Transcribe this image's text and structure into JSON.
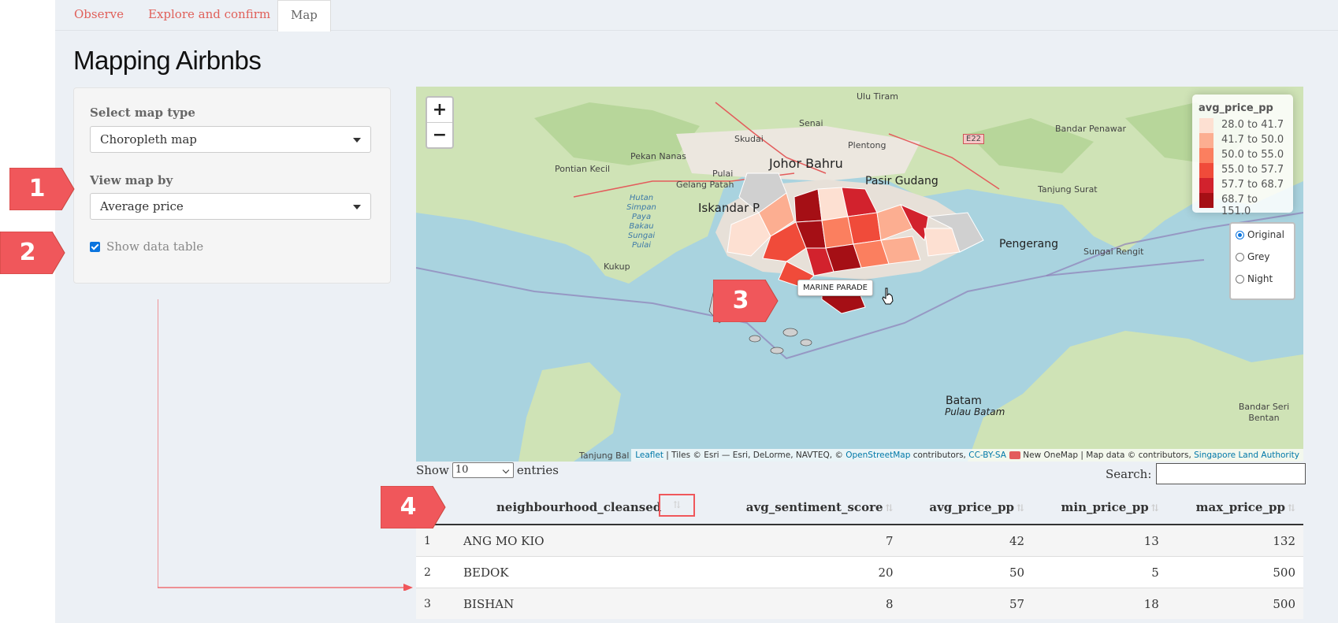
{
  "tabs": [
    {
      "label": "Observe",
      "active": false
    },
    {
      "label": "Explore and confirm",
      "active": false
    },
    {
      "label": "Map",
      "active": true
    }
  ],
  "page_title": "Mapping Airbnbs",
  "sidebar": {
    "map_type_label": "Select map type",
    "map_type_value": "Choropleth map",
    "view_by_label": "View map by",
    "view_by_value": "Average price",
    "show_table_label": "Show data table",
    "show_table_checked": true
  },
  "callouts": [
    "1",
    "2",
    "3",
    "4"
  ],
  "callout_color": "#f0575b",
  "map": {
    "zoom_in": "+",
    "zoom_out": "−",
    "legend_title": "avg_price_pp",
    "legend": [
      {
        "label": "28.0 to 41.7",
        "color": "#fde0d2"
      },
      {
        "label": "41.7 to 50.0",
        "color": "#fcae91"
      },
      {
        "label": "50.0 to 55.0",
        "color": "#fb7f5f"
      },
      {
        "label": "55.0 to 57.7",
        "color": "#f04b3a"
      },
      {
        "label": "57.7 to 68.7",
        "color": "#d2222d"
      },
      {
        "label": "68.7 to 151.0",
        "color": "#a50f15"
      }
    ],
    "basemaps": [
      {
        "label": "Original",
        "selected": true
      },
      {
        "label": "Grey",
        "selected": false
      },
      {
        "label": "Night",
        "selected": false
      }
    ],
    "tooltip": "MARINE PARADE",
    "labels": {
      "ulu_tiram": "Ulu Tiram",
      "skudai": "Skudai",
      "senai": "Senai",
      "pekan_nanas": "Pekan Nanas",
      "pontian": "Pontian Kecil",
      "johor_bahru": "Johor Bahru",
      "plentong": "Plentong",
      "pulai": "Pulai",
      "gelang_patah": "Gelang Patah",
      "iskandar": "Iskandar P",
      "pasir_gudang": "Pasir Gudang",
      "tanjung_surat": "Tanjung Surat",
      "bandar_penawar": "Bandar Penawar",
      "e22": "E22",
      "hutan": "Hutan Simpan Paya Bakau Sungai Pulai",
      "kukup": "Kukup",
      "pengerang": "Pengerang",
      "sungai_rengit": "Sungai Rengit",
      "batam": "Batam",
      "pulau_batam": "Pulau Batam",
      "bandar_seri": "Bandar Seri Bentan",
      "tanjung_bal": "Tanjung Bal"
    },
    "attribution": {
      "leaflet": "Leaflet",
      "tiles": " | Tiles © Esri — Esri, DeLorme, NAVTEQ, © ",
      "osm": "OpenStreetMap",
      "contrib": " contributors, ",
      "ccbysa": "CC-BY-SA",
      "onemap": " New OneMap | Map data © contributors, ",
      "sla": "Singapore Land Authority"
    }
  },
  "table_controls": {
    "show_label": "Show",
    "entries_value": "10",
    "entries_label": "entries",
    "search_label": "Search:"
  },
  "table": {
    "columns": [
      "neighbourhood_cleansed",
      "avg_sentiment_score",
      "avg_price_pp",
      "min_price_pp",
      "max_price_pp"
    ],
    "rows": [
      {
        "idx": "1",
        "name": "ANG MO KIO",
        "sentiment": "7",
        "avg": "42",
        "min": "13",
        "max": "132"
      },
      {
        "idx": "2",
        "name": "BEDOK",
        "sentiment": "20",
        "avg": "50",
        "min": "5",
        "max": "500"
      },
      {
        "idx": "3",
        "name": "BISHAN",
        "sentiment": "8",
        "avg": "57",
        "min": "18",
        "max": "500"
      }
    ]
  }
}
